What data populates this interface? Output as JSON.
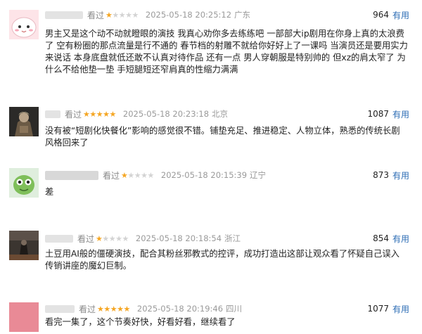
{
  "reviews": [
    {
      "watched": "看过",
      "rating": 1,
      "time": "2025-05-18 20:25:12",
      "location": "广东",
      "votes": "964",
      "useful_label": "有用",
      "content": "男主又是这个动不动就瞪眼的演技 我真心劝你多去练练吧 一部部大ip剧用在你身上真的太浪费了 空有粉圈的那点流量是行不通的 春节档的射雕不就给你好好上了一课吗 当演员还是要用实力来说话 本身底盘就低还敢不认真对待作品 还有一点 男人穿朝服是特别帅的 但xz的肩太窄了 为什么不给他垫一垫 手短腿短还窄肩真的性缩力满满"
    },
    {
      "watched": "看过",
      "rating": 5,
      "time": "2025-05-18 20:23:18",
      "location": "北京",
      "votes": "1087",
      "useful_label": "有用",
      "content": "没有被“短剧化快餐化”影响的感觉很不错。铺垫充足、推进稳定、人物立体，熟悉的传统长剧风格回来了"
    },
    {
      "watched": "看过",
      "rating": 1,
      "time": "2025-05-18 20:15:39",
      "location": "辽宁",
      "votes": "873",
      "useful_label": "有用",
      "content": "差"
    },
    {
      "watched": "看过",
      "rating": 1,
      "time": "2025-05-18 20:18:54",
      "location": "浙江",
      "votes": "854",
      "useful_label": "有用",
      "content": "土豆用AI般的僵硬演技，配合其粉丝邪教式的控评，成功打造出这部让观众看了怀疑自己误入传销讲座的魔幻巨制。"
    },
    {
      "watched": "看过",
      "rating": 5,
      "time": "2025-05-18 20:19:46",
      "location": "四川",
      "votes": "1077",
      "useful_label": "有用",
      "content": "看完一集了，这个节奏好快，好看好看，继续看了"
    }
  ],
  "avatars": [
    "cartoon-blob-avatar",
    "armored-character-avatar",
    "green-cartoon-avatar",
    "dark-figure-avatar",
    "pink-square-avatar"
  ]
}
